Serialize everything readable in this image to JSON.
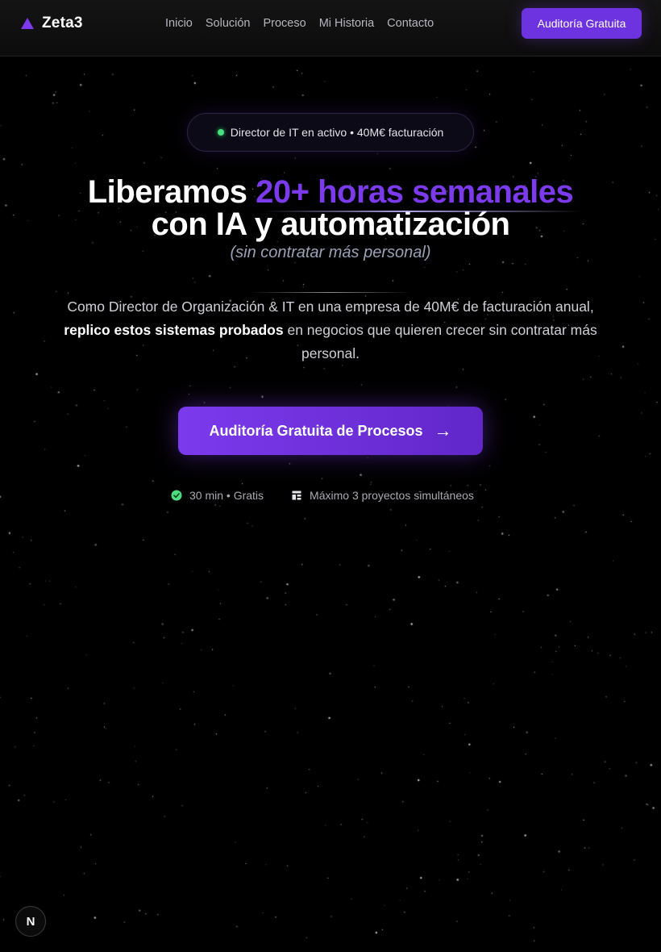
{
  "nav": {
    "brand": "Zeta3",
    "links": [
      "Inicio",
      "Solución",
      "Proceso",
      "Mi Historia",
      "Contacto"
    ],
    "cta_label": "Auditoría Gratuita"
  },
  "hero": {
    "badge_text": "Director de IT en activo • 40M€ facturación",
    "headline_start": "Liberamos ",
    "headline_highlight": "20+ horas semanales",
    "headline_line2": "con IA y automatización",
    "subhead": "(sin contratar más personal)",
    "desc_line1": "Como Director de Organización & IT en una empresa de 40M€ de facturación anual,",
    "desc_strong": "replico estos sistemas probados",
    "desc_rest": " en negocios que quieren crecer sin contratar más personal.",
    "cta_label": "Auditoría Gratuita de Procesos",
    "cta_arrow": "→",
    "meta_time": "30 min • Gratis",
    "meta_projects": "Máximo 3 proyectos simultáneos"
  },
  "dev_badge": "N",
  "colors": {
    "accent": "#7c3aed",
    "background": "#000000",
    "status_green": "#4ade80"
  },
  "icons": [
    "triangle-logo-icon",
    "check-circle-icon",
    "layout-icon",
    "arrow-right-icon"
  ]
}
